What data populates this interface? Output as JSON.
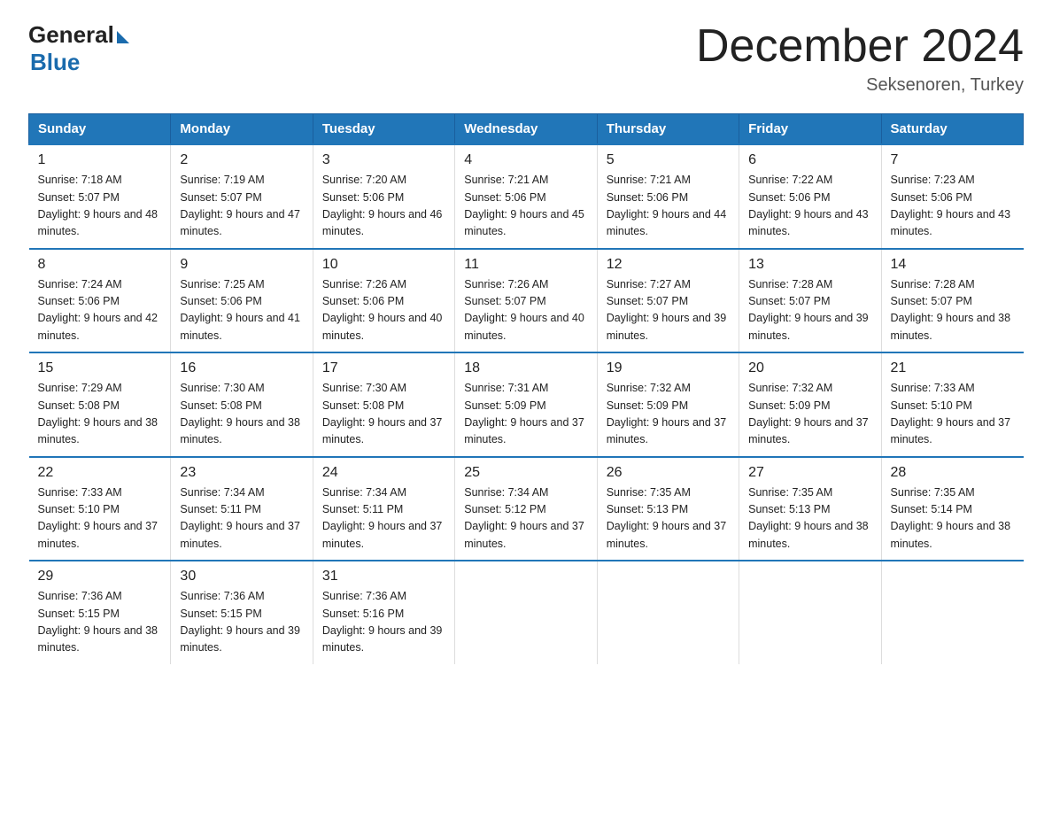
{
  "header": {
    "logo_general": "General",
    "logo_blue": "Blue",
    "month_title": "December 2024",
    "location": "Seksenoren, Turkey"
  },
  "weekdays": [
    "Sunday",
    "Monday",
    "Tuesday",
    "Wednesday",
    "Thursday",
    "Friday",
    "Saturday"
  ],
  "weeks": [
    [
      {
        "day": "1",
        "sunrise": "7:18 AM",
        "sunset": "5:07 PM",
        "daylight": "9 hours and 48 minutes."
      },
      {
        "day": "2",
        "sunrise": "7:19 AM",
        "sunset": "5:07 PM",
        "daylight": "9 hours and 47 minutes."
      },
      {
        "day": "3",
        "sunrise": "7:20 AM",
        "sunset": "5:06 PM",
        "daylight": "9 hours and 46 minutes."
      },
      {
        "day": "4",
        "sunrise": "7:21 AM",
        "sunset": "5:06 PM",
        "daylight": "9 hours and 45 minutes."
      },
      {
        "day": "5",
        "sunrise": "7:21 AM",
        "sunset": "5:06 PM",
        "daylight": "9 hours and 44 minutes."
      },
      {
        "day": "6",
        "sunrise": "7:22 AM",
        "sunset": "5:06 PM",
        "daylight": "9 hours and 43 minutes."
      },
      {
        "day": "7",
        "sunrise": "7:23 AM",
        "sunset": "5:06 PM",
        "daylight": "9 hours and 43 minutes."
      }
    ],
    [
      {
        "day": "8",
        "sunrise": "7:24 AM",
        "sunset": "5:06 PM",
        "daylight": "9 hours and 42 minutes."
      },
      {
        "day": "9",
        "sunrise": "7:25 AM",
        "sunset": "5:06 PM",
        "daylight": "9 hours and 41 minutes."
      },
      {
        "day": "10",
        "sunrise": "7:26 AM",
        "sunset": "5:06 PM",
        "daylight": "9 hours and 40 minutes."
      },
      {
        "day": "11",
        "sunrise": "7:26 AM",
        "sunset": "5:07 PM",
        "daylight": "9 hours and 40 minutes."
      },
      {
        "day": "12",
        "sunrise": "7:27 AM",
        "sunset": "5:07 PM",
        "daylight": "9 hours and 39 minutes."
      },
      {
        "day": "13",
        "sunrise": "7:28 AM",
        "sunset": "5:07 PM",
        "daylight": "9 hours and 39 minutes."
      },
      {
        "day": "14",
        "sunrise": "7:28 AM",
        "sunset": "5:07 PM",
        "daylight": "9 hours and 38 minutes."
      }
    ],
    [
      {
        "day": "15",
        "sunrise": "7:29 AM",
        "sunset": "5:08 PM",
        "daylight": "9 hours and 38 minutes."
      },
      {
        "day": "16",
        "sunrise": "7:30 AM",
        "sunset": "5:08 PM",
        "daylight": "9 hours and 38 minutes."
      },
      {
        "day": "17",
        "sunrise": "7:30 AM",
        "sunset": "5:08 PM",
        "daylight": "9 hours and 37 minutes."
      },
      {
        "day": "18",
        "sunrise": "7:31 AM",
        "sunset": "5:09 PM",
        "daylight": "9 hours and 37 minutes."
      },
      {
        "day": "19",
        "sunrise": "7:32 AM",
        "sunset": "5:09 PM",
        "daylight": "9 hours and 37 minutes."
      },
      {
        "day": "20",
        "sunrise": "7:32 AM",
        "sunset": "5:09 PM",
        "daylight": "9 hours and 37 minutes."
      },
      {
        "day": "21",
        "sunrise": "7:33 AM",
        "sunset": "5:10 PM",
        "daylight": "9 hours and 37 minutes."
      }
    ],
    [
      {
        "day": "22",
        "sunrise": "7:33 AM",
        "sunset": "5:10 PM",
        "daylight": "9 hours and 37 minutes."
      },
      {
        "day": "23",
        "sunrise": "7:34 AM",
        "sunset": "5:11 PM",
        "daylight": "9 hours and 37 minutes."
      },
      {
        "day": "24",
        "sunrise": "7:34 AM",
        "sunset": "5:11 PM",
        "daylight": "9 hours and 37 minutes."
      },
      {
        "day": "25",
        "sunrise": "7:34 AM",
        "sunset": "5:12 PM",
        "daylight": "9 hours and 37 minutes."
      },
      {
        "day": "26",
        "sunrise": "7:35 AM",
        "sunset": "5:13 PM",
        "daylight": "9 hours and 37 minutes."
      },
      {
        "day": "27",
        "sunrise": "7:35 AM",
        "sunset": "5:13 PM",
        "daylight": "9 hours and 38 minutes."
      },
      {
        "day": "28",
        "sunrise": "7:35 AM",
        "sunset": "5:14 PM",
        "daylight": "9 hours and 38 minutes."
      }
    ],
    [
      {
        "day": "29",
        "sunrise": "7:36 AM",
        "sunset": "5:15 PM",
        "daylight": "9 hours and 38 minutes."
      },
      {
        "day": "30",
        "sunrise": "7:36 AM",
        "sunset": "5:15 PM",
        "daylight": "9 hours and 39 minutes."
      },
      {
        "day": "31",
        "sunrise": "7:36 AM",
        "sunset": "5:16 PM",
        "daylight": "9 hours and 39 minutes."
      },
      null,
      null,
      null,
      null
    ]
  ]
}
